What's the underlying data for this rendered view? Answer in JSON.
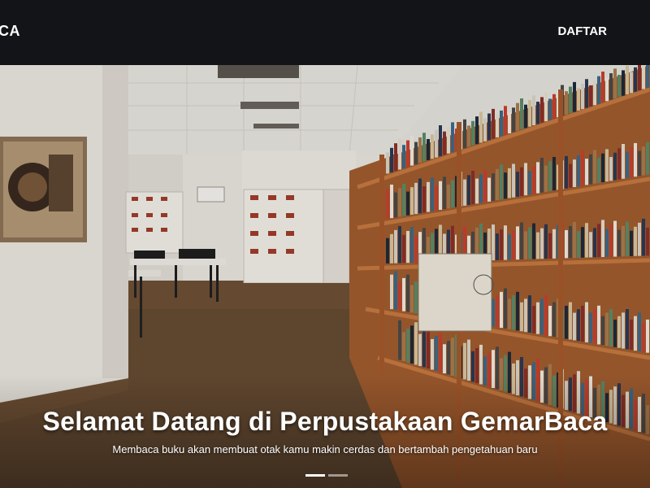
{
  "navbar": {
    "brand": "CA",
    "link": "DAFTAR"
  },
  "hero": {
    "title": "Selamat Datang di Perpustakaan GemarBaca",
    "subtitle": "Membaca buku akan membuat otak kamu makin cerdas dan bertambah pengetahuan baru",
    "carousel": {
      "slides": 2,
      "active": 1
    }
  },
  "colors": {
    "navbar": "#121417",
    "wall": "#ebe7e0",
    "floor": "#6e5035",
    "shelf": "#b86a36"
  }
}
